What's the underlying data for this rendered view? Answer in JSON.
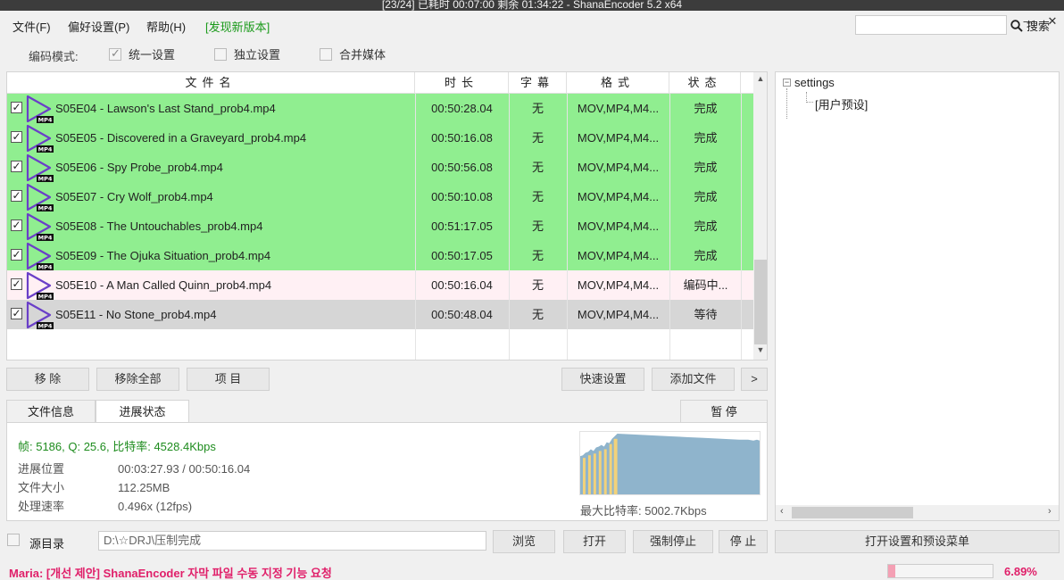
{
  "window": {
    "title": "[23/24] 已耗时 00:07:00  剩余 01:34:22 - ShanaEncoder 5.2 x64",
    "minimize": "—",
    "close": "✕"
  },
  "menu": {
    "file": "文件(F)",
    "prefs": "偏好设置(P)",
    "help": "帮助(H)",
    "new_version": "[发现新版本]",
    "search_label": "搜索",
    "search_value": ""
  },
  "mode": {
    "label": "编码模式:",
    "unified": "统一设置",
    "unified_checked": true,
    "independent": "独立设置",
    "independent_checked": false,
    "merge": "合并媒体",
    "merge_checked": false
  },
  "table": {
    "headers": [
      "文件名",
      "时长",
      "字幕",
      "格式",
      "状态"
    ],
    "rows": [
      {
        "name": "S05E04 - Lawson's Last Stand_prob4.mp4",
        "duration": "00:50:28.04",
        "subtitle": "无",
        "format": "MOV,MP4,M4...",
        "status": "完成",
        "state": "done",
        "checked": true
      },
      {
        "name": "S05E05 - Discovered in a Graveyard_prob4.mp4",
        "duration": "00:50:16.08",
        "subtitle": "无",
        "format": "MOV,MP4,M4...",
        "status": "完成",
        "state": "done",
        "checked": true
      },
      {
        "name": "S05E06 - Spy Probe_prob4.mp4",
        "duration": "00:50:56.08",
        "subtitle": "无",
        "format": "MOV,MP4,M4...",
        "status": "完成",
        "state": "done",
        "checked": true
      },
      {
        "name": "S05E07 - Cry Wolf_prob4.mp4",
        "duration": "00:50:10.08",
        "subtitle": "无",
        "format": "MOV,MP4,M4...",
        "status": "完成",
        "state": "done",
        "checked": true
      },
      {
        "name": "S05E08 - The Untouchables_prob4.mp4",
        "duration": "00:51:17.05",
        "subtitle": "无",
        "format": "MOV,MP4,M4...",
        "status": "完成",
        "state": "done",
        "checked": true
      },
      {
        "name": "S05E09 - The Ojuka Situation_prob4.mp4",
        "duration": "00:50:17.05",
        "subtitle": "无",
        "format": "MOV,MP4,M4...",
        "status": "完成",
        "state": "done",
        "checked": true
      },
      {
        "name": "S05E10 - A Man Called Quinn_prob4.mp4",
        "duration": "00:50:16.04",
        "subtitle": "无",
        "format": "MOV,MP4,M4...",
        "status": "编码中...",
        "state": "encoding",
        "checked": true
      },
      {
        "name": "S05E11 - No Stone_prob4.mp4",
        "duration": "00:50:48.04",
        "subtitle": "无",
        "format": "MOV,MP4,M4...",
        "status": "等待",
        "state": "waiting",
        "checked": true
      }
    ],
    "icon_badge": "MP4"
  },
  "list_buttons": {
    "remove": "移 除",
    "remove_all": "移除全部",
    "items": "项 目",
    "quick_settings": "快速设置",
    "add_file": "添加文件",
    "more": ">"
  },
  "tabs": {
    "file_info": "文件信息",
    "progress": "进展状态",
    "pause": "暂 停"
  },
  "progress_panel": {
    "stats": "帧: 5186, Q: 25.6, 比特率: 4528.4Kbps",
    "position_label": "进展位置",
    "position_value": "00:03:27.93 / 00:50:16.04",
    "size_label": "文件大小",
    "size_value": "112.25MB",
    "speed_label": "处理速率",
    "speed_value": "0.496x (12fps)",
    "max_bitrate": "最大比特率: 5002.7Kbps",
    "chart_colors": {
      "blue": "#8fb4cc",
      "yellow": "#f2d27a"
    }
  },
  "tree": {
    "root": "settings",
    "toggle": "−",
    "child": "[用户预设]"
  },
  "output": {
    "source_dir_label": "源目录",
    "source_dir_checked": false,
    "path": "D:\\☆DRJ\\压制完成",
    "browse": "浏览",
    "open": "打开",
    "force_stop": "强制停止",
    "stop": "停 止",
    "open_settings_menu": "打开设置和预设菜单"
  },
  "status": {
    "message": "Maria: [개선 제안] ShanaEncoder 자막 파일 수동 지정 기능 요청",
    "progress_fraction": 0.0689,
    "progress_text": "6.89%",
    "accent": "#e0206a"
  }
}
